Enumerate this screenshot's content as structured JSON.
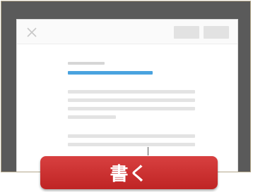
{
  "window": {
    "close_icon": "close-x-icon"
  },
  "cta": {
    "write_label": "書く"
  },
  "colors": {
    "accent_blue": "#4aa3df",
    "button_red": "#c92b2b",
    "frame_dark": "#5a5a5a"
  }
}
